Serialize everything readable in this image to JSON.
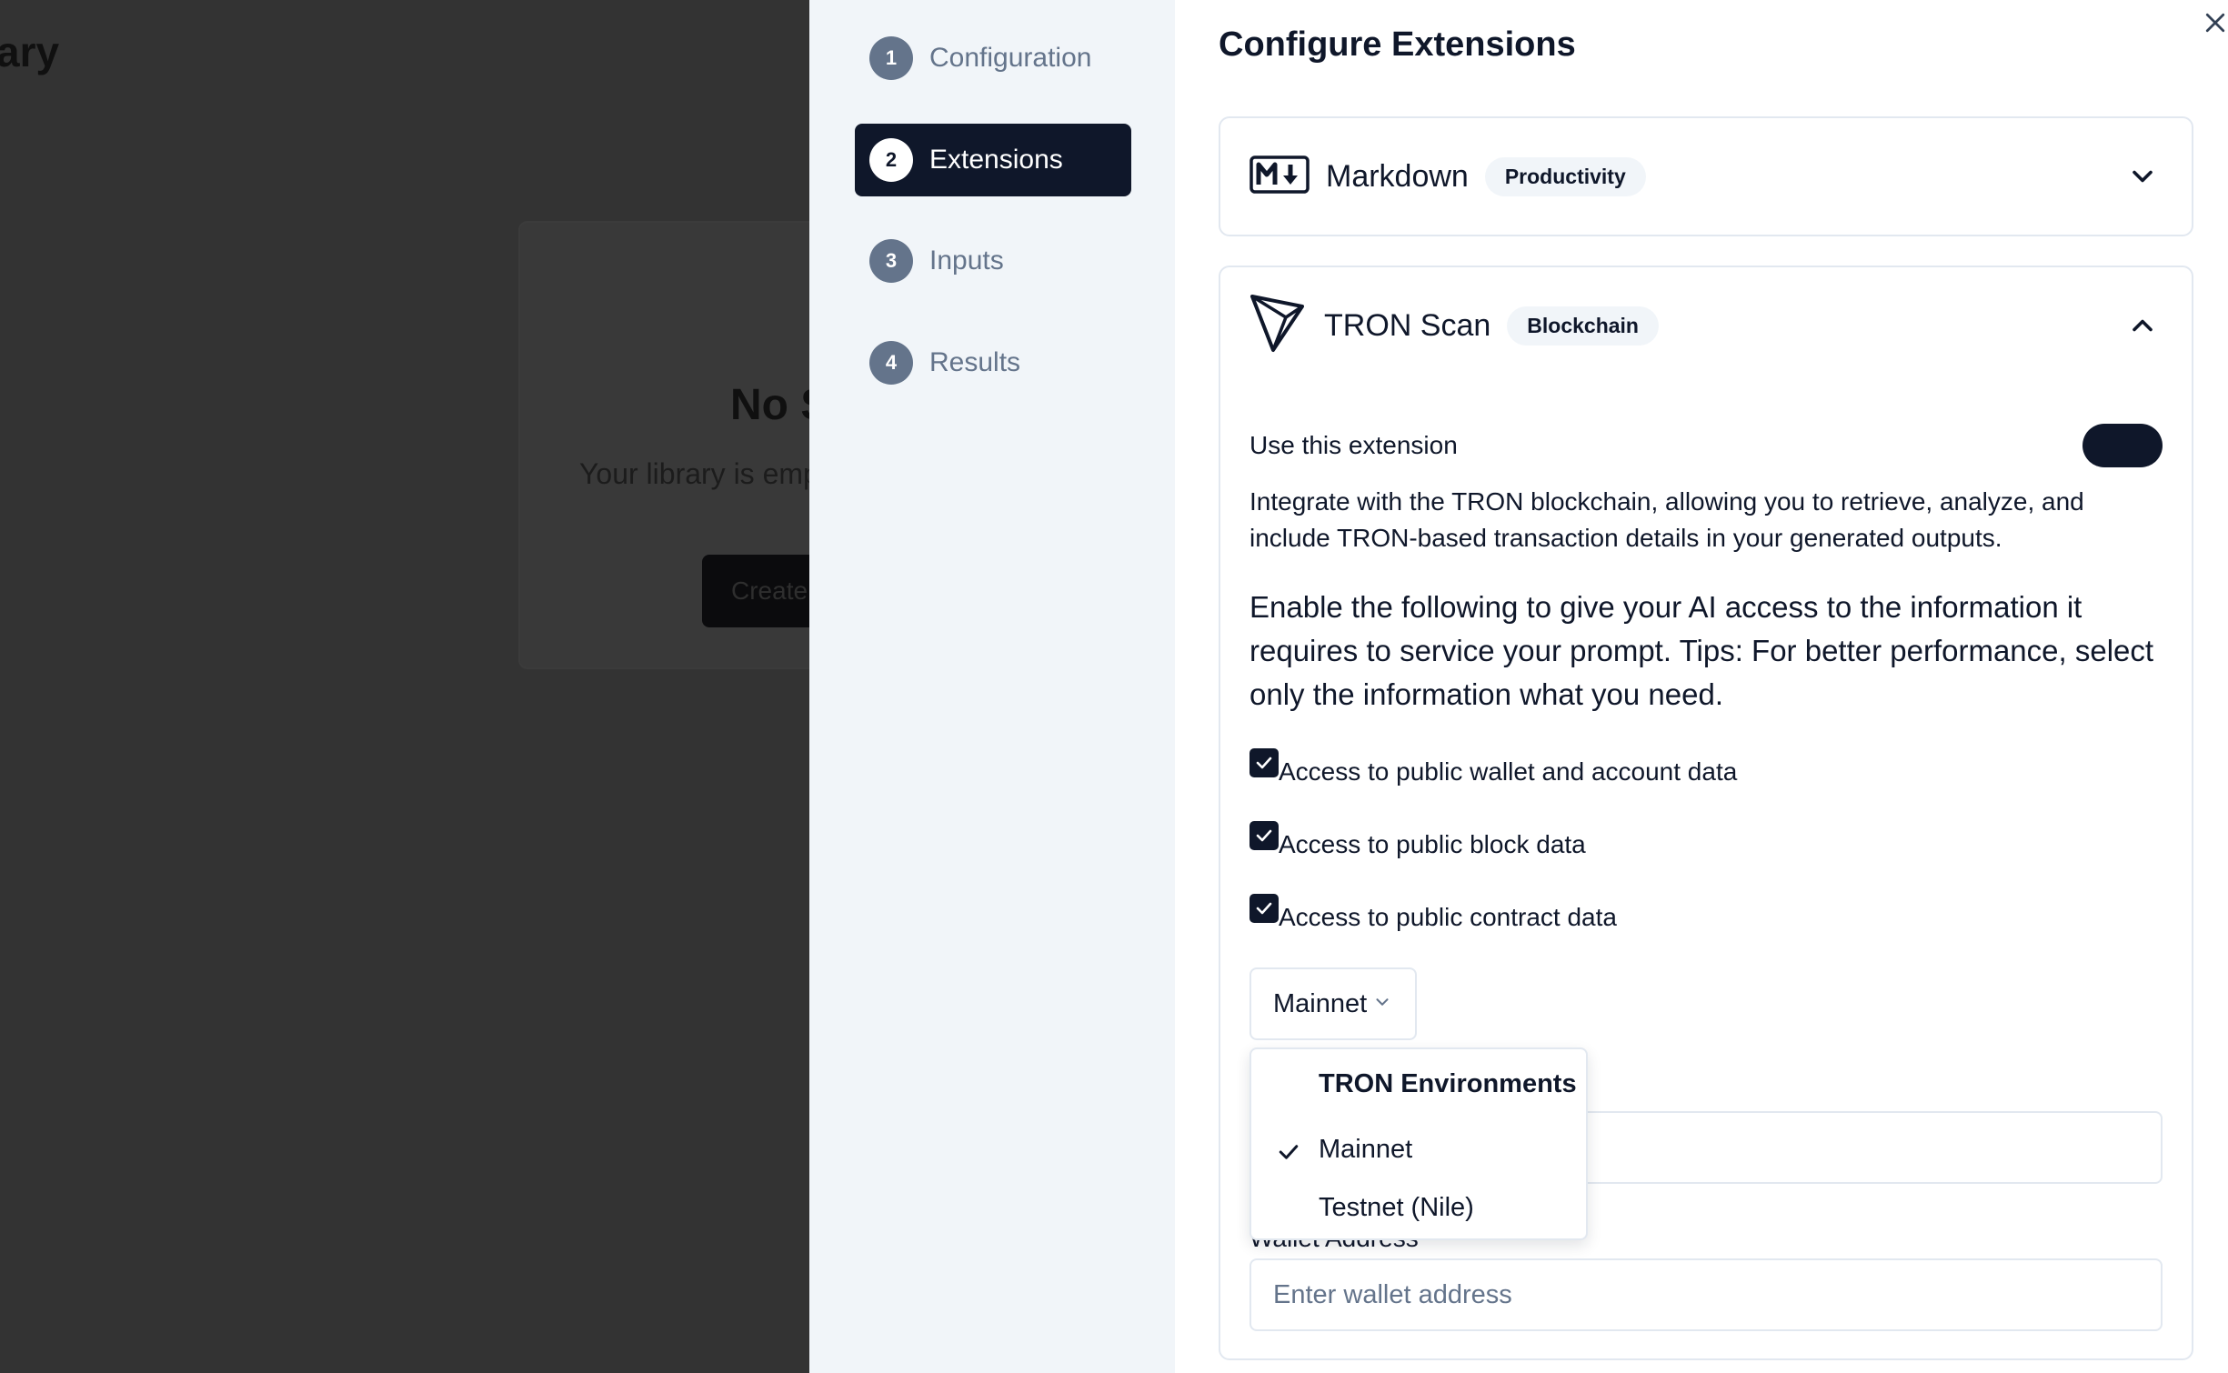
{
  "background": {
    "page_title_fragment": "ary",
    "empty_heading_fragment": "No S",
    "empty_sub_fragment": "Your library is emp",
    "create_button_fragment": "Create"
  },
  "steps": [
    {
      "num": "1",
      "label": "Configuration",
      "active": false
    },
    {
      "num": "2",
      "label": "Extensions",
      "active": true
    },
    {
      "num": "3",
      "label": "Inputs",
      "active": false
    },
    {
      "num": "4",
      "label": "Results",
      "active": false
    }
  ],
  "panel": {
    "title": "Configure Extensions",
    "close_icon": "close-icon"
  },
  "extensions": {
    "markdown": {
      "name": "Markdown",
      "badge": "Productivity",
      "icon": "markdown-logo-icon",
      "expanded": false
    },
    "tron": {
      "name": "TRON Scan",
      "badge": "Blockchain",
      "icon": "tron-logo-icon",
      "expanded": true,
      "use_label": "Use this extension",
      "enabled": true,
      "description": "Integrate with the TRON blockchain, allowing you to retrieve, analyze, and include TRON-based transaction details in your generated outputs.",
      "enable_text": "Enable the following to give your AI access to the information it requires to service your prompt. Tips: For better performance, select only the information what you need.",
      "permissions": [
        {
          "label": "Access to public wallet and account data",
          "checked": true
        },
        {
          "label": "Access to public block data",
          "checked": true
        },
        {
          "label": "Access to public contract data",
          "checked": true
        }
      ],
      "environment_select": {
        "value": "Mainnet",
        "dropdown_heading": "TRON Environments",
        "options": [
          {
            "label": "Mainnet",
            "selected": true
          },
          {
            "label": "Testnet (Nile)",
            "selected": false
          }
        ]
      },
      "wallet_label_visible": "Wallet Address",
      "wallet_placeholder": "Enter wallet address"
    }
  },
  "colors": {
    "primary": "#0f172a",
    "muted": "#64748b",
    "sidebar_bg": "#f1f5f9",
    "border": "#e2e8f0",
    "overlay": "#333333"
  }
}
